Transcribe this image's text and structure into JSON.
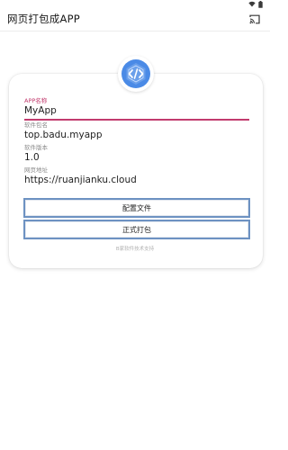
{
  "app_bar": {
    "title": "网页打包成APP",
    "action_icon": "cast-icon"
  },
  "form": {
    "fields": [
      {
        "label": "APP名称",
        "value": "MyApp",
        "active": true
      },
      {
        "label": "软件包名",
        "value": "top.badu.myapp",
        "active": false
      },
      {
        "label": "软件版本",
        "value": "1.0",
        "active": false
      },
      {
        "label": "网页地址",
        "value": "https://ruanjianku.cloud",
        "active": false
      }
    ]
  },
  "buttons": {
    "config_label": "配置文件",
    "build_label": "正式打包"
  },
  "footer": {
    "credit": "B家软件技术支持"
  },
  "colors": {
    "accent": "#c23b6e",
    "button_border": "#6d92c2",
    "logo_blue": "#3f7fe0"
  }
}
